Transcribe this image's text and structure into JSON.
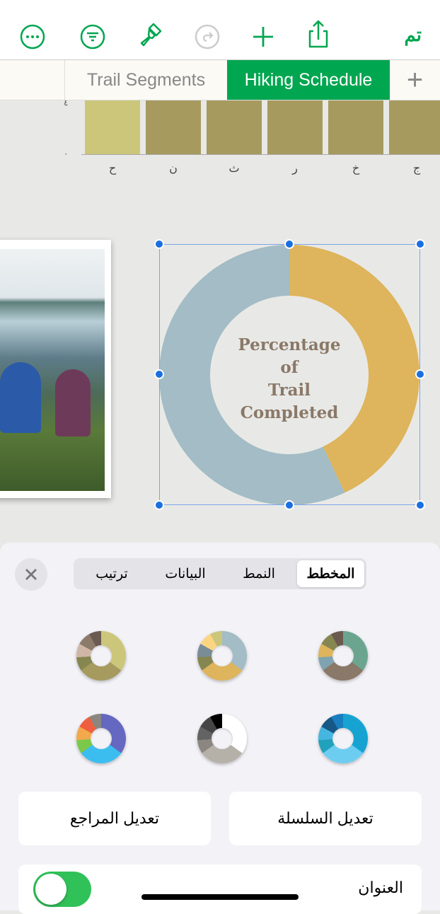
{
  "toolbar": {
    "done_label": "تم",
    "icons": [
      "more-icon",
      "filter-icon",
      "format-brush-icon",
      "redo-icon",
      "add-icon",
      "share-icon"
    ],
    "accent": "#00a650"
  },
  "tabs": [
    {
      "label": "Trail Segments",
      "active": false
    },
    {
      "label": "Hiking Schedule",
      "active": true
    }
  ],
  "add_tab_label": "+",
  "bar_chart": {
    "y_ticks": [
      "٤",
      "٠"
    ],
    "categories": [
      "ح",
      "ن",
      "ث",
      "ر",
      "خ",
      "ج"
    ],
    "values": [
      4,
      4,
      4,
      4,
      4,
      4
    ],
    "ylim": [
      0,
      4
    ],
    "colors": [
      "#ccc67b",
      "#a69a5f",
      "#a69a5f",
      "#a69a5f",
      "#a69a5f",
      "#a69a5f"
    ]
  },
  "chart_data": {
    "type": "pie",
    "title": "Percentage of Trail Completed",
    "title_lines": [
      "Percentage",
      "of",
      "Trail",
      "Completed"
    ],
    "values": [
      43,
      57
    ],
    "colors": [
      "#deb45c",
      "#a3bcc5"
    ]
  },
  "sheet": {
    "segments": [
      {
        "label": "المخطط",
        "active": true
      },
      {
        "label": "النمط",
        "active": false
      },
      {
        "label": "البيانات",
        "active": false
      },
      {
        "label": "ترتيب",
        "active": false
      }
    ],
    "swatches": [
      [
        "#6ba590",
        "#8a7868",
        "#7fa3b0",
        "#deb45c",
        "#868650",
        "#6b5a50"
      ],
      [
        "#a3bcc5",
        "#deb45c",
        "#868650",
        "#7a8c96",
        "#fcd583",
        "#ccc67b"
      ],
      [
        "#ccc67b",
        "#a69a5f",
        "#868650",
        "#cfb6a5",
        "#8c7a6a",
        "#6b5a50"
      ],
      [
        "#16a3d2",
        "#6dcdf0",
        "#21a1bb",
        "#45b6e0",
        "#155785",
        "#1a7dbf"
      ],
      [
        "#ffffff",
        "#b5b0a8",
        "#8b8680",
        "#636363",
        "#454545",
        "#000000"
      ],
      [
        "#6468c0",
        "#3bbeef",
        "#7bc94b",
        "#f3a84b",
        "#ef5f3f",
        "#8b8680"
      ]
    ],
    "edit_series_label": "تعديل السلسلة",
    "edit_references_label": "تعديل المراجع",
    "title_row_label": "العنوان",
    "title_toggle_on": true
  }
}
